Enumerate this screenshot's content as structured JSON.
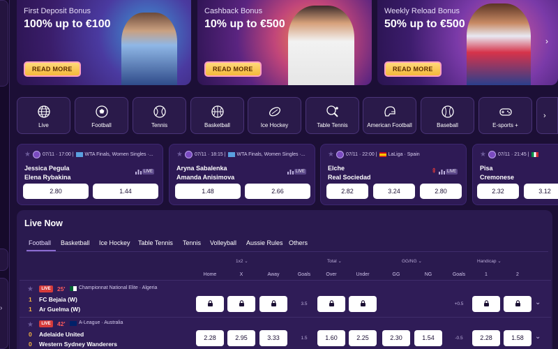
{
  "banners": [
    {
      "title": "First Deposit Bonus",
      "offer": "100% up to €100",
      "button": "READ MORE"
    },
    {
      "title": "Cashback Bonus",
      "offer": "10% up to €500",
      "button": "READ MORE"
    },
    {
      "title": "Weekly Reload Bonus",
      "offer": "50% up to €500",
      "button": "READ MORE"
    }
  ],
  "banner_next": "›",
  "sports": [
    {
      "label": "Live",
      "icon": "globe-icon"
    },
    {
      "label": "Football",
      "icon": "football-icon"
    },
    {
      "label": "Tennis",
      "icon": "tennis-ball-icon"
    },
    {
      "label": "Basketball",
      "icon": "basketball-icon"
    },
    {
      "label": "Ice Hockey",
      "icon": "ice-hockey-puck-icon"
    },
    {
      "label": "Table Tennis",
      "icon": "table-tennis-icon"
    },
    {
      "label": "American Football",
      "icon": "american-football-helmet-icon"
    },
    {
      "label": "Baseball",
      "icon": "baseball-icon"
    },
    {
      "label": "E-sports +",
      "icon": "gamepad-icon"
    }
  ],
  "sports_next": "›",
  "cards": [
    {
      "meta": "07/11 · 17:00 |",
      "league": "WTA Finals, Women Singles ·...",
      "team1": "Jessica Pegula",
      "team2": "Elena Rybakina",
      "live": "LIVE",
      "odds": [
        "2.80",
        "1.44"
      ]
    },
    {
      "meta": "07/11 · 18:15 |",
      "league": "WTA Finals, Women Singles ·...",
      "team1": "Aryna Sabalenka",
      "team2": "Amanda Anisimova",
      "live": "LIVE",
      "odds": [
        "1.48",
        "2.66"
      ]
    },
    {
      "meta": "07/11 · 22:00 |",
      "league": "LaLiga · Spain",
      "team1": "Elche",
      "team2": "Real Sociedad",
      "live": "LIVE",
      "odds": [
        "2.82",
        "3.24",
        "2.80"
      ]
    },
    {
      "meta": "07/11 · 21:45 |",
      "league": "",
      "team1": "Pisa",
      "team2": "Cremonese",
      "odds": [
        "2.32",
        "3.12"
      ]
    }
  ],
  "live_now": {
    "title": "Live Now",
    "tabs": [
      "Football",
      "Basketball",
      "Ice Hockey",
      "Table Tennis",
      "Tennis",
      "Volleyball",
      "Aussie Rules",
      "Others"
    ],
    "groups": {
      "g1": "1x2 ⌄",
      "g2": "Total ⌄",
      "g3": "GG/NG ⌄",
      "g4": "Handicap ⌄"
    },
    "columns": [
      "Home",
      "X",
      "Away",
      "Goals",
      "Over",
      "Under",
      "GG",
      "NG",
      "Goals",
      "1",
      "2"
    ],
    "matches": [
      {
        "live": "LIVE",
        "minute": "25'",
        "league": "Championnat National Elite · Algeria",
        "score1": "1",
        "score2": "1",
        "team1": "FC Bejaia (W)",
        "team2": "Ar Guelma (W)",
        "goals": "3.5",
        "handicap": "+0.5",
        "odds": [],
        "expand": "⌄"
      },
      {
        "live": "LIVE",
        "minute": "42'",
        "league": "A-League · Australia",
        "score1": "0",
        "score2": "0",
        "team1": "Adelaide United",
        "team2": "Western Sydney Wanderers",
        "goals": "1.5",
        "handicap": "-0.5",
        "odds": [
          "2.28",
          "2.95",
          "3.33",
          "1.60",
          "2.25",
          "2.30",
          "1.54",
          "2.28",
          "1.58"
        ],
        "expand": "⌄"
      }
    ]
  },
  "colors": {
    "bg": "#1c0f36",
    "panel": "#2a1a4f",
    "accent": "#8a6bd0",
    "live_red": "#d63b3b",
    "score_gold": "#f6b740"
  }
}
